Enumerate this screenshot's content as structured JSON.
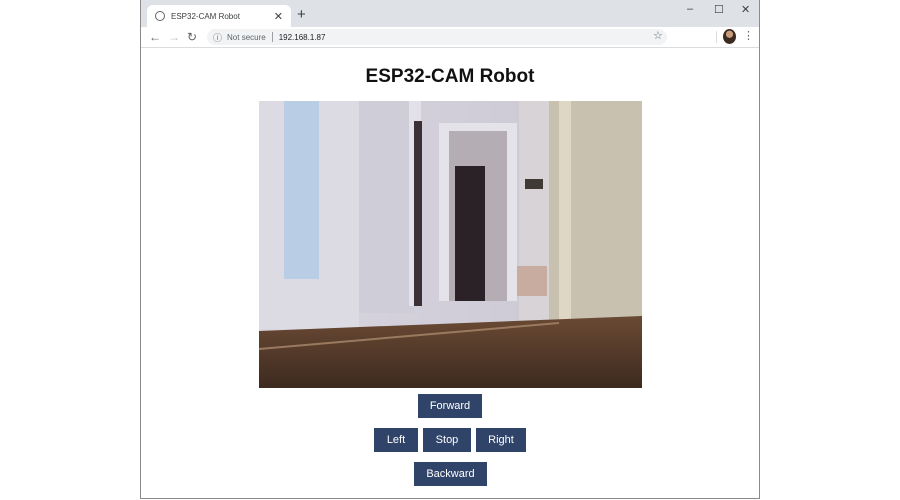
{
  "browser": {
    "tab_title": "ESP32-CAM Robot",
    "new_tab_label": "+",
    "security_label": "Not secure",
    "url": "192.168.1.87",
    "window_controls": {
      "minimize": "–",
      "maximize": "☐",
      "close": "✕"
    },
    "icons": {
      "back": "←",
      "forward": "→",
      "reload": "↻",
      "info": "ⓘ",
      "star": "☆",
      "menu": "⋮",
      "tab_close": "✕"
    }
  },
  "page": {
    "title": "ESP32-CAM Robot",
    "camera_stream_alt": "Camera stream: hallway with wooden floor and open doors",
    "buttons": {
      "forward": "Forward",
      "left": "Left",
      "stop": "Stop",
      "right": "Right",
      "backward": "Backward"
    },
    "button_color": "#2f4468"
  }
}
